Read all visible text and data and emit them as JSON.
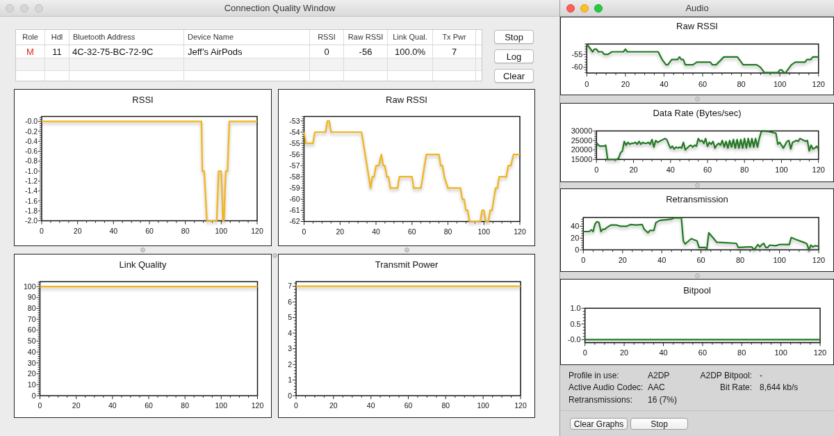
{
  "connection_window": {
    "title": "Connection Quality Window",
    "active": false,
    "table": {
      "columns": [
        "Role",
        "Hdl",
        "Bluetooth Address",
        "Device Name",
        "RSSI",
        "Raw RSSI",
        "Link Qual.",
        "Tx Pwr"
      ],
      "rows": [
        [
          "M",
          "11",
          "4C-32-75-BC-72-9C",
          "Jeff’s AirPods",
          "0",
          "-56",
          "100.0%",
          "7"
        ]
      ]
    },
    "buttons": [
      "Stop",
      "Log",
      "Clear"
    ],
    "charts": [
      {
        "chart_data": {
          "type": "line",
          "title": "RSSI",
          "x": [
            0,
            89,
            89.5,
            90.5,
            92,
            97.5,
            98.5,
            100,
            101,
            101.5,
            102.5,
            103.5,
            104.5,
            120
          ],
          "series": [
            {
              "color": "#f3b418",
              "values": [
                0,
                0,
                -1,
                -1,
                -2,
                -2,
                -1,
                -1,
                -2,
                -2,
                -1,
                -1,
                0,
                0
              ]
            }
          ],
          "xlim": [
            0,
            120
          ],
          "ylim": [
            -2,
            0.1
          ],
          "xticks": [
            0,
            20,
            40,
            60,
            80,
            100,
            120
          ],
          "yticks": [
            {
              "value": 0,
              "label": "-0.0"
            },
            {
              "value": -0.2,
              "label": "-0.2"
            },
            {
              "value": -0.4,
              "label": "-0.4"
            },
            {
              "value": -0.6,
              "label": "-0.6"
            },
            {
              "value": -0.8,
              "label": "-0.8"
            },
            {
              "value": -1,
              "label": "-1.0"
            },
            {
              "value": -1.2,
              "label": "-1.2"
            },
            {
              "value": -1.4,
              "label": "-1.4"
            },
            {
              "value": -1.6,
              "label": "-1.6"
            },
            {
              "value": -1.8,
              "label": "-1.8"
            },
            {
              "value": -2,
              "label": "-2.0"
            }
          ]
        }
      },
      {
        "chart_data": {
          "type": "line",
          "title": "Raw RSSI",
          "x": [
            0,
            1,
            5,
            6,
            12,
            13,
            14,
            15,
            32,
            37,
            38,
            39,
            40,
            41.5,
            43,
            44,
            45,
            46,
            47,
            48,
            52,
            53,
            60,
            61,
            65,
            68,
            75,
            76,
            77,
            78,
            80,
            87,
            88,
            89,
            90,
            91,
            92,
            98,
            99,
            100,
            101,
            102.5,
            103.5,
            104.5,
            105.5,
            106.5,
            107.5,
            108.5,
            112.5,
            113.5,
            115,
            116.5,
            120
          ],
          "series": [
            {
              "color": "#f3b418",
              "values": [
                -54,
                -55,
                -55,
                -54,
                -54,
                -53,
                -53,
                -54,
                -54,
                -59,
                -58,
                -58,
                -57,
                -57,
                -56,
                -57,
                -57,
                -58,
                -58,
                -59,
                -59,
                -58,
                -58,
                -59,
                -59,
                -56,
                -56,
                -57,
                -57,
                -58,
                -59,
                -59,
                -60,
                -60,
                -61,
                -61,
                -62,
                -62,
                -61,
                -61,
                -62,
                -62,
                -61,
                -61,
                -60,
                -59,
                -59,
                -58,
                -58,
                -57,
                -57,
                -56,
                -56
              ]
            }
          ],
          "xlim": [
            0,
            120
          ],
          "ylim": [
            -62,
            -52.6
          ],
          "xticks": [
            0,
            20,
            40,
            60,
            80,
            100,
            120
          ],
          "yticks": [
            -53,
            -54,
            -55,
            -56,
            -57,
            -58,
            -59,
            -60,
            -61,
            -62
          ]
        }
      },
      {
        "chart_data": {
          "type": "line",
          "title": "Link Quality",
          "x": [
            0,
            120
          ],
          "series": [
            {
              "color": "#f3b418",
              "values": [
                100,
                100
              ]
            }
          ],
          "xlim": [
            0,
            120
          ],
          "ylim": [
            0,
            104.5
          ],
          "xticks": [
            0,
            20,
            40,
            60,
            80,
            100,
            120
          ],
          "yticks": [
            0,
            10,
            20,
            30,
            40,
            50,
            60,
            70,
            80,
            90,
            100
          ]
        }
      },
      {
        "chart_data": {
          "type": "line",
          "title": "Transmit Power",
          "x": [
            0,
            120
          ],
          "series": [
            {
              "color": "#f3b418",
              "values": [
                7,
                7
              ]
            }
          ],
          "xlim": [
            0,
            120
          ],
          "ylim": [
            0,
            7.3
          ],
          "xticks": [
            0,
            20,
            40,
            60,
            80,
            100,
            120
          ],
          "yticks": [
            0,
            1,
            2,
            3,
            4,
            5,
            6,
            7
          ]
        }
      }
    ]
  },
  "audio_window": {
    "title": "Audio",
    "active": true,
    "charts": [
      {
        "chart_data": {
          "type": "line",
          "title": "Raw RSSI",
          "x": [
            0,
            1,
            3,
            4,
            5,
            6,
            8,
            9,
            11,
            13,
            19,
            20,
            21,
            37,
            39,
            41,
            42,
            44,
            47,
            48,
            49,
            50,
            51,
            55,
            57,
            64,
            65,
            67,
            71,
            78,
            81,
            88,
            90,
            92,
            99,
            100,
            101,
            102,
            103,
            105,
            106,
            108,
            113,
            114,
            116,
            117,
            120
          ],
          "series": [
            {
              "color": "#217a21",
              "values": [
                -51,
                -52,
                -54,
                -53,
                -53,
                -54,
                -54,
                -55,
                -55,
                -54,
                -54,
                -53,
                -54,
                -54,
                -57,
                -59,
                -59,
                -57,
                -57,
                -56,
                -57,
                -57,
                -59,
                -59,
                -58,
                -58,
                -59,
                -59,
                -56,
                -56,
                -59,
                -59,
                -60,
                -62,
                -62,
                -61,
                -61,
                -62,
                -62,
                -60,
                -59,
                -58,
                -58,
                -57,
                -57,
                -56,
                -56
              ]
            }
          ],
          "xlim": [
            0,
            120
          ],
          "ylim": [
            -62.2,
            -51
          ],
          "xticks": [
            0,
            20,
            40,
            60,
            80,
            100,
            120
          ],
          "yticks": [
            -55,
            -60
          ]
        }
      },
      {
        "chart_data": {
          "type": "line",
          "title": "Data Rate (Bytes/sec)",
          "x": [
            0,
            1,
            2,
            4,
            5,
            6,
            11,
            12,
            13,
            14,
            15,
            16,
            17,
            18,
            19,
            20,
            21,
            22,
            23,
            24,
            25,
            26,
            27,
            28,
            29,
            30,
            31,
            32,
            33,
            34,
            35,
            36,
            37,
            38,
            39,
            40,
            41,
            42,
            43,
            44,
            45,
            46,
            47,
            48,
            49,
            50,
            51,
            52,
            53,
            54,
            55,
            56,
            57,
            58,
            59,
            60,
            61,
            62,
            63,
            64,
            65,
            66,
            67,
            68,
            69,
            70,
            71,
            72,
            73,
            74,
            75,
            76,
            77,
            78,
            79,
            80,
            81,
            82,
            83,
            84,
            85,
            86,
            87,
            88,
            89,
            90,
            93,
            97,
            98,
            99,
            101,
            103,
            104,
            105,
            106,
            108,
            109,
            110,
            111,
            113,
            114,
            115,
            116,
            117,
            118,
            119,
            120
          ],
          "series": [
            {
              "color": "#217a21",
              "values": [
                23800,
                22500,
                22000,
                22000,
                22500,
                15000,
                15000,
                15800,
                18500,
                19500,
                24500,
                22500,
                24000,
                23000,
                23500,
                23500,
                24000,
                23000,
                24500,
                23000,
                24000,
                23500,
                23500,
                24000,
                23000,
                25500,
                21500,
                25000,
                24000,
                24500,
                25000,
                25500,
                26000,
                25500,
                23000,
                21000,
                22000,
                20500,
                21500,
                21000,
                21500,
                21000,
                24000,
                20000,
                21000,
                22000,
                22500,
                21500,
                22500,
                22000,
                26000,
                24500,
                25000,
                23500,
                26000,
                22000,
                24000,
                23000,
                24500,
                21000,
                22500,
                23500,
                22500,
                25000,
                21500,
                24500,
                21000,
                25000,
                21500,
                25500,
                21000,
                25500,
                21000,
                25500,
                21000,
                26000,
                21000,
                26000,
                21500,
                26000,
                21500,
                26000,
                21500,
                26000,
                29500,
                30000,
                29700,
                28800,
                23000,
                24000,
                21000,
                24500,
                25000,
                20500,
                24000,
                25000,
                24500,
                26000,
                25500,
                24500,
                25000,
                19500,
                22500,
                20500,
                21000,
                22000,
                20500
              ]
            }
          ],
          "xlim": [
            0,
            120
          ],
          "ylim": [
            15000,
            30000
          ],
          "xticks": [
            0,
            20,
            40,
            60,
            80,
            100,
            120
          ],
          "yticks": [
            15000,
            20000,
            25000,
            30000
          ]
        }
      },
      {
        "chart_data": {
          "type": "line",
          "title": "Retransmission",
          "x": [
            0,
            3,
            4,
            5,
            6,
            7,
            8,
            9,
            10,
            11,
            12,
            14,
            16,
            17,
            19,
            22,
            24,
            27,
            30,
            31,
            33,
            34,
            36,
            37,
            38,
            39,
            42,
            45,
            46,
            49,
            50,
            51,
            52,
            55,
            58,
            59,
            62,
            63,
            64,
            66,
            68,
            73,
            78,
            79,
            84,
            86,
            87,
            89,
            90,
            91,
            92,
            93,
            94,
            95,
            98,
            100,
            105,
            106,
            108,
            113,
            114,
            115,
            116,
            117,
            118,
            120
          ],
          "series": [
            {
              "color": "#217a21",
              "values": [
                31,
                31,
                34,
                31,
                44,
                48,
                46,
                31,
                35,
                35,
                38,
                42,
                42,
                42,
                40,
                40,
                43,
                42,
                43,
                35,
                29,
                33,
                33,
                46,
                48,
                50,
                51,
                52,
                54,
                54,
                54,
                15,
                10,
                19,
                15,
                4,
                4,
                2,
                29,
                21,
                13,
                12,
                11,
                4,
                5,
                5,
                0,
                9,
                5,
                9,
                11,
                4,
                4,
                8,
                7,
                9,
                9,
                21,
                18,
                12,
                10,
                0,
                8,
                5,
                7,
                6
              ]
            }
          ],
          "xlim": [
            0,
            120
          ],
          "ylim": [
            0,
            55
          ],
          "xticks": [
            0,
            20,
            40,
            60,
            80,
            100,
            120
          ],
          "yticks": [
            0,
            20,
            40
          ]
        }
      },
      {
        "chart_data": {
          "type": "line",
          "title": "Bitpool",
          "x": [
            0,
            120
          ],
          "series": [
            {
              "color": "#217a21",
              "values": [
                0,
                0
              ]
            }
          ],
          "xlim": [
            0,
            120
          ],
          "ylim": [
            -0.095,
            1
          ],
          "xticks": [
            0,
            20,
            40,
            60,
            80,
            100,
            120
          ],
          "yticks": [
            {
              "value": 0,
              "label": "-0.0"
            },
            {
              "value": 0.5,
              "label": "0.5"
            },
            {
              "value": 1,
              "label": "1.0"
            }
          ]
        }
      }
    ],
    "info_rows": [
      [
        {
          "label": "Profile in use:",
          "value": "A2DP"
        },
        {
          "label": "A2DP Bitpool:",
          "value": "-"
        }
      ],
      [
        {
          "label": "Active Audio Codec:",
          "value": "AAC"
        },
        {
          "label": "Bit Rate:",
          "value": "8,644 kb/s"
        }
      ],
      [
        {
          "label": "Retransmissions:",
          "value": "16 (7%)"
        }
      ]
    ],
    "buttons": [
      "Clear Graphs",
      "Stop"
    ]
  }
}
